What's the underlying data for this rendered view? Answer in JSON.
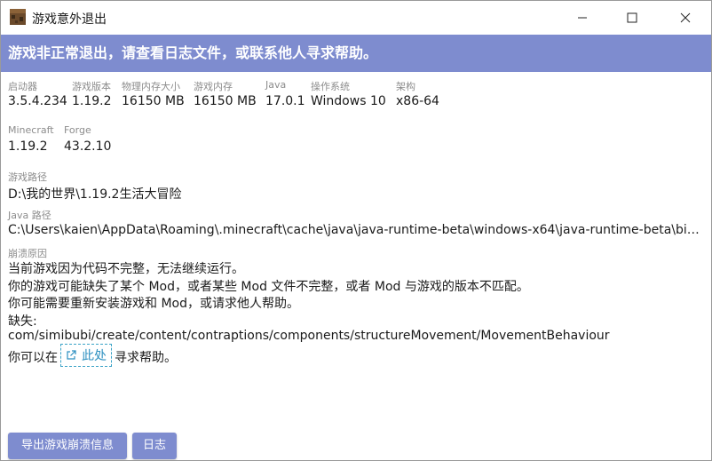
{
  "window": {
    "title": "游戏意外退出"
  },
  "banner": {
    "text": "游戏非正常退出，请查看日志文件，或联系他人寻求帮助。"
  },
  "info": {
    "launcher": {
      "label": "启动器",
      "value": "3.5.4.234"
    },
    "game_version": {
      "label": "游戏版本",
      "value": "1.19.2"
    },
    "physical_memory": {
      "label": "物理内存大小",
      "value": "16150 MB"
    },
    "game_memory": {
      "label": "游戏内存",
      "value": "16150 MB"
    },
    "java": {
      "label": "Java",
      "value": "17.0.1"
    },
    "os": {
      "label": "操作系统",
      "value": "Windows 10"
    },
    "arch": {
      "label": "架构",
      "value": "x86-64"
    },
    "minecraft": {
      "label": "Minecraft",
      "value": "1.19.2"
    },
    "forge": {
      "label": "Forge",
      "value": "43.2.10"
    },
    "game_path": {
      "label": "游戏路径",
      "value": "D:\\我的世界\\1.19.2生活大冒险"
    },
    "java_path": {
      "label": "Java 路径",
      "value": "C:\\Users\\kaien\\AppData\\Roaming\\.minecraft\\cache\\java\\java-runtime-beta\\windows-x64\\java-runtime-beta\\bin\\javaw.exe"
    }
  },
  "crash": {
    "label": "崩溃原因",
    "lines": [
      "当前游戏因为代码不完整，无法继续运行。",
      "你的游戏可能缺失了某个 Mod，或者某些 Mod 文件不完整，或者 Mod 与游戏的版本不匹配。",
      "你可能需要重新安装游戏和 Mod，或请求他人帮助。",
      "缺失:",
      "com/simibubi/create/content/contraptions/components/structureMovement/MovementBehaviour"
    ],
    "help_prefix": "你可以在",
    "help_link": "此处",
    "help_suffix": "寻求帮助。"
  },
  "buttons": {
    "export": "导出游戏崩溃信息",
    "logs": "日志"
  },
  "icons": {
    "app": "minecraft-block-icon",
    "link": "external-link-icon"
  },
  "colors": {
    "accent": "#7e8ccf",
    "link": "#2c8fc0"
  }
}
